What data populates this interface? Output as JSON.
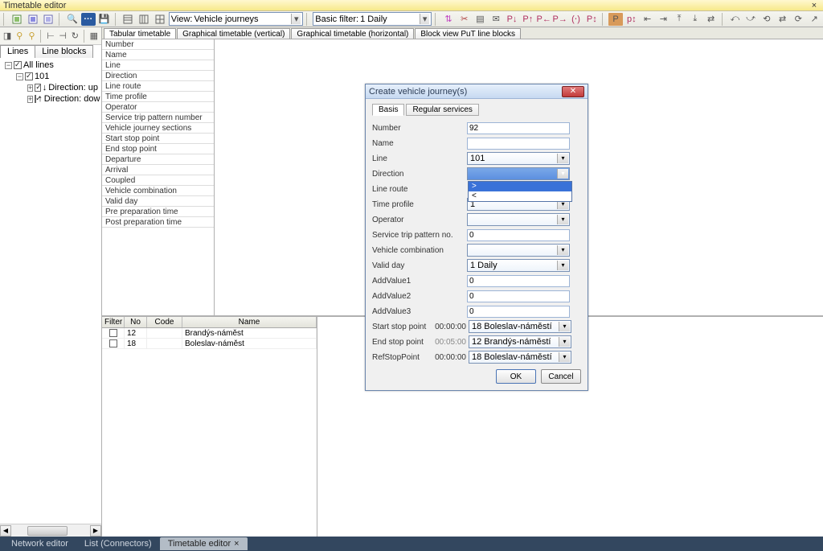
{
  "window": {
    "title": "Timetable editor"
  },
  "toolbar": {
    "view_label": "View:",
    "view_value": "Vehicle journeys",
    "filter_label": "Basic filter:",
    "filter_value": "1 Daily"
  },
  "left_tabs": {
    "lines": "Lines",
    "line_blocks": "Line blocks"
  },
  "tree": {
    "all_lines": "All lines",
    "line_101": "101",
    "dir_up": "Direction: up",
    "dir_down": "Direction: dow"
  },
  "main_tabs": {
    "tabular": "Tabular timetable",
    "gv": "Graphical timetable (vertical)",
    "gh": "Graphical timetable (horizontal)",
    "block": "Block view PuT line blocks"
  },
  "prop_list": [
    "Number",
    "Name",
    "Line",
    "Direction",
    "Line route",
    "Time profile",
    "Operator",
    "Service trip pattern number",
    "Vehicle journey sections",
    "Start stop point",
    "End stop point",
    "Departure",
    "Arrival",
    "Coupled",
    "Vehicle combination",
    "Valid day",
    "Pre preparation time",
    "Post preparation time"
  ],
  "grid": {
    "headers": {
      "filter": "Filter",
      "no": "No",
      "code": "Code",
      "name": "Name"
    },
    "rows": [
      {
        "no": "12",
        "code": "",
        "name": "Brandýs-náměst"
      },
      {
        "no": "18",
        "code": "",
        "name": "Boleslav-náměst"
      }
    ]
  },
  "dialog": {
    "title": "Create vehicle journey(s)",
    "tabs": {
      "basis": "Basis",
      "regular": "Regular services"
    },
    "fields": {
      "number_lbl": "Number",
      "number_val": "92",
      "name_lbl": "Name",
      "name_val": "",
      "line_lbl": "Line",
      "line_val": "101",
      "direction_lbl": "Direction",
      "direction_val": ">",
      "lineroute_lbl": "Line route",
      "lineroute_val": "<",
      "timeprofile_lbl": "Time profile",
      "timeprofile_val": "1",
      "operator_lbl": "Operator",
      "operator_val": "",
      "stp_lbl": "Service trip pattern no.",
      "stp_val": "0",
      "vcomb_lbl": "Vehicle combination",
      "vcomb_val": "",
      "validday_lbl": "Valid day",
      "validday_val": "1 Daily",
      "av1_lbl": "AddValue1",
      "av1_val": "0",
      "av2_lbl": "AddValue2",
      "av2_val": "0",
      "av3_lbl": "AddValue3",
      "av3_val": "0",
      "ssp_lbl": "Start stop point",
      "ssp_time": "00:00:00",
      "ssp_val": "18 Boleslav-náměstí",
      "esp_lbl": "End stop point",
      "esp_time": "00:05:00",
      "esp_val": "12 Brandýs-náměstí",
      "ref_lbl": "RefStopPoint",
      "ref_time": "00:00:00",
      "ref_val": "18 Boleslav-náměstí"
    },
    "direction_options": {
      "gt": ">",
      "lt": "<"
    },
    "ok": "OK",
    "cancel": "Cancel"
  },
  "bottom_tabs": {
    "network": "Network editor",
    "list": "List (Connectors)",
    "timetable": "Timetable editor"
  }
}
